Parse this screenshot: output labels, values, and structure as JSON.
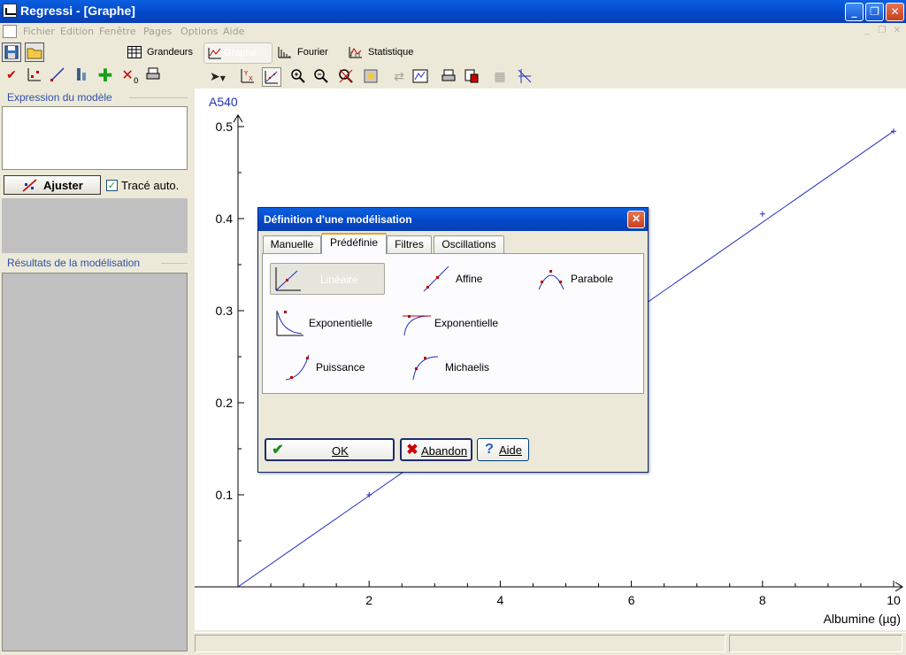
{
  "window": {
    "title": "Regressi  - [Graphe]"
  },
  "menu": [
    "Fichier",
    "Edition",
    "Fenêtre",
    "Pages",
    "Options",
    "Aide"
  ],
  "pages": {
    "grandeurs": "Grandeurs",
    "graphe": "Graphe",
    "fourier": "Fourier",
    "statistique": "Statistique"
  },
  "left": {
    "expression_caption": "Expression du modèle",
    "ajuster_label": "Ajuster",
    "trace_auto_label": "Tracé auto.",
    "trace_auto_checked": true,
    "results_caption": "Résultats de la modélisation"
  },
  "chart_data": {
    "type": "scatter",
    "ylabel": "A540",
    "xlabel": "Albumine (µg)",
    "xlim": [
      0,
      10.3
    ],
    "ylim": [
      0,
      0.52
    ],
    "x_ticks": [
      "2",
      "4",
      "6",
      "8",
      "10"
    ],
    "y_ticks": [
      "0.1",
      "0.2",
      "0.3",
      "0.4",
      "0.5"
    ],
    "points": [
      {
        "x": 2,
        "y": 0.1
      },
      {
        "x": 8,
        "y": 0.405
      },
      {
        "x": 10,
        "y": 0.495
      }
    ],
    "model_line": {
      "slope": 0.0495,
      "intercept": 0,
      "color": "#1f2fbf"
    },
    "grid": false
  },
  "dialog": {
    "title": "Définition d'une modélisation",
    "tabs": [
      "Manuelle",
      "Prédéfinie",
      "Filtres",
      "Oscillations"
    ],
    "selected_tab": "Prédéfinie",
    "models": [
      "Linéaire",
      "Affine",
      "Parabole",
      "Exponentielle",
      "Exponentielle",
      "Puissance",
      "Michaelis"
    ],
    "selected_model": "Linéaire",
    "buttons": {
      "ok": "OK",
      "abandon": "Abandon",
      "aide": "Aide"
    }
  }
}
